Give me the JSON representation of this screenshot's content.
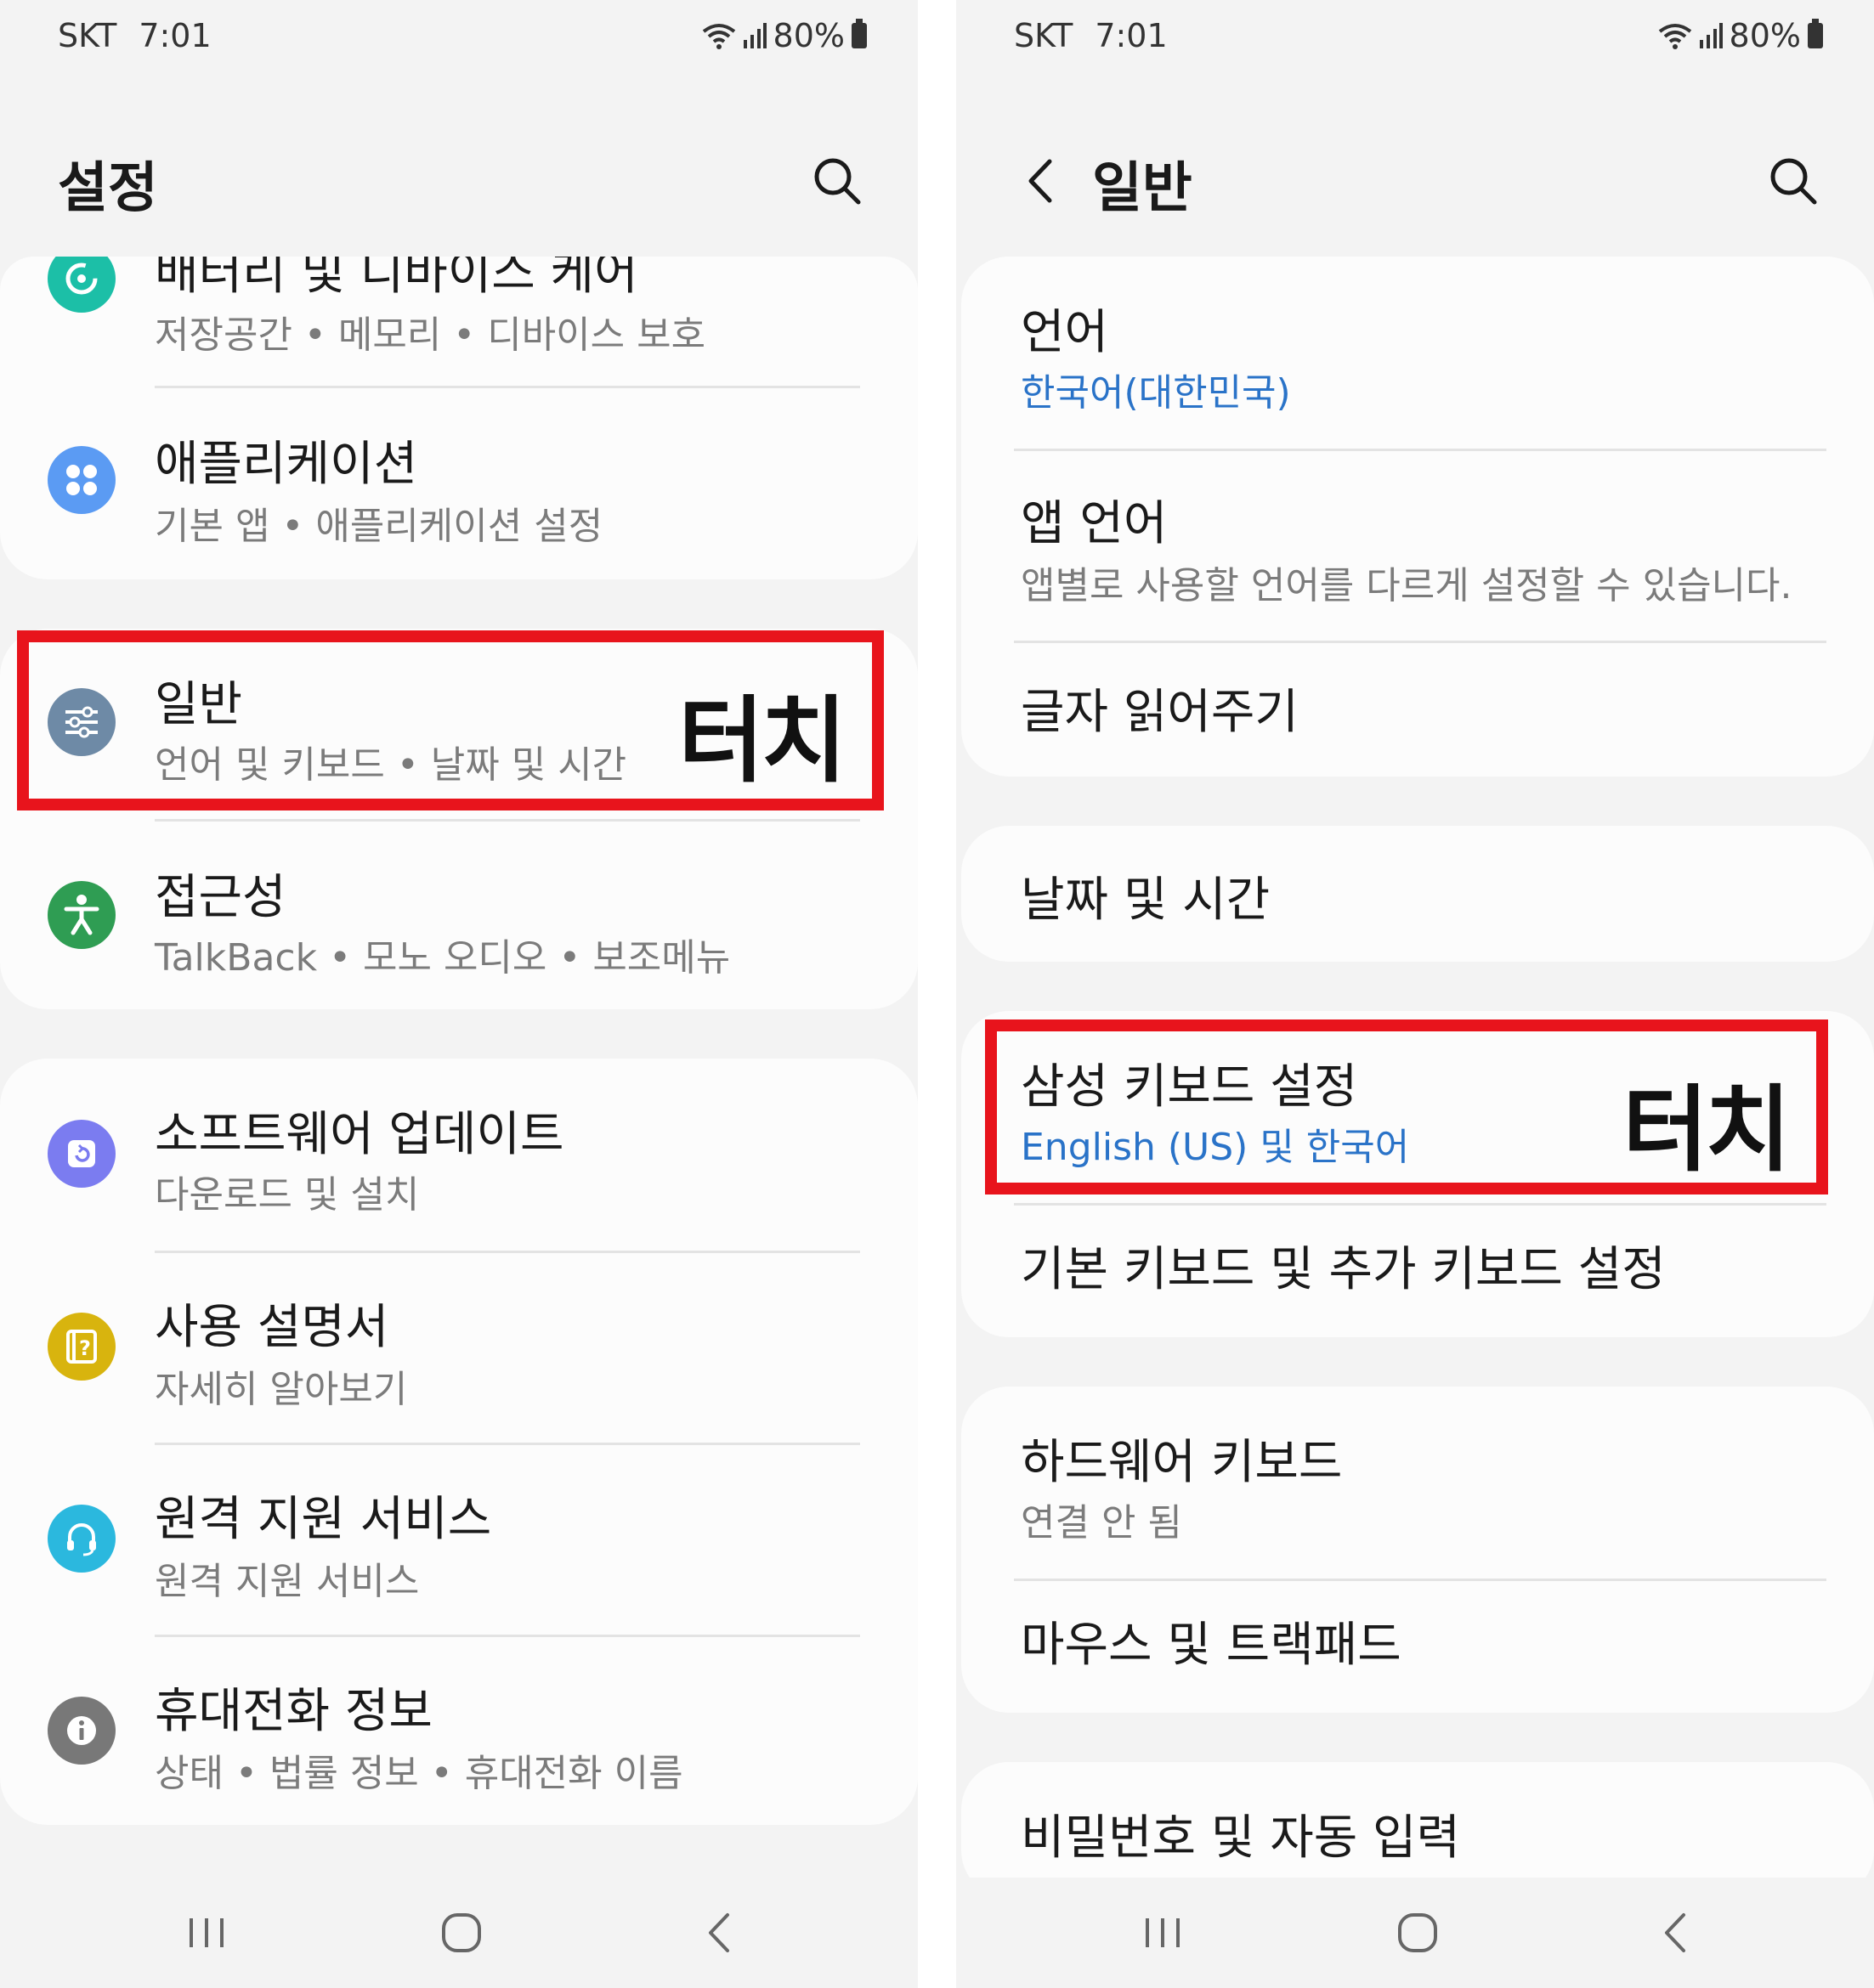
{
  "status": {
    "carrier": "SKT",
    "time": "7:01",
    "battery": "80%"
  },
  "left": {
    "title": "설정",
    "cards": [
      {
        "items": [
          {
            "title": "배터리 및 디바이스 케어",
            "subtitle": "저장공간 • 메모리 • 디바이스 보호",
            "icon": "device-care-icon",
            "color": "#1cbfa7"
          },
          {
            "title": "애플리케이션",
            "subtitle": "기본 앱 • 애플리케이션 설정",
            "icon": "apps-icon",
            "color": "#5b9bf3"
          }
        ]
      },
      {
        "items": [
          {
            "title": "일반",
            "subtitle": "언어 및 키보드 • 날짜 및 시간",
            "icon": "general-management-icon",
            "color": "#6e8aa6"
          },
          {
            "title": "접근성",
            "subtitle": "TalkBack • 모노 오디오 • 보조메뉴",
            "icon": "accessibility-icon",
            "color": "#2f9d53"
          }
        ]
      },
      {
        "items": [
          {
            "title": "소프트웨어 업데이트",
            "subtitle": "다운로드 및 설치",
            "icon": "software-update-icon",
            "color": "#7b7cf0"
          },
          {
            "title": "사용 설명서",
            "subtitle": "자세히 알아보기",
            "icon": "user-manual-icon",
            "color": "#d8b40e"
          },
          {
            "title": "원격 지원 서비스",
            "subtitle": "원격 지원 서비스",
            "icon": "remote-support-icon",
            "color": "#2bb8de"
          },
          {
            "title": "휴대전화 정보",
            "subtitle": "상태 • 법률 정보 • 휴대전화 이름",
            "icon": "phone-info-icon",
            "color": "#787878"
          }
        ]
      }
    ],
    "touch_label": "터치"
  },
  "right": {
    "title": "일반",
    "cards": [
      {
        "items": [
          {
            "title": "언어",
            "subtitle": "한국어(대한민국)",
            "subtitle_style": "blue"
          },
          {
            "title": "앱 언어",
            "subtitle": "앱별로 사용할 언어를 다르게 설정할 수 있습니다."
          },
          {
            "title": "글자 읽어주기"
          }
        ]
      },
      {
        "items": [
          {
            "title": "날짜 및 시간"
          }
        ]
      },
      {
        "items": [
          {
            "title": "삼성 키보드 설정",
            "subtitle": "English (US) 및 한국어",
            "subtitle_style": "blue"
          },
          {
            "title": "기본 키보드 및 추가 키보드 설정"
          }
        ]
      },
      {
        "items": [
          {
            "title": "하드웨어 키보드",
            "subtitle": "연결 안 됨"
          },
          {
            "title": "마우스 및 트랙패드"
          }
        ]
      },
      {
        "items": [
          {
            "title": "비밀번호 및 자동 입력"
          }
        ]
      }
    ],
    "touch_label": "터치"
  },
  "colors": {
    "highlight": "#e8141c",
    "link_blue": "#2a73c8"
  }
}
